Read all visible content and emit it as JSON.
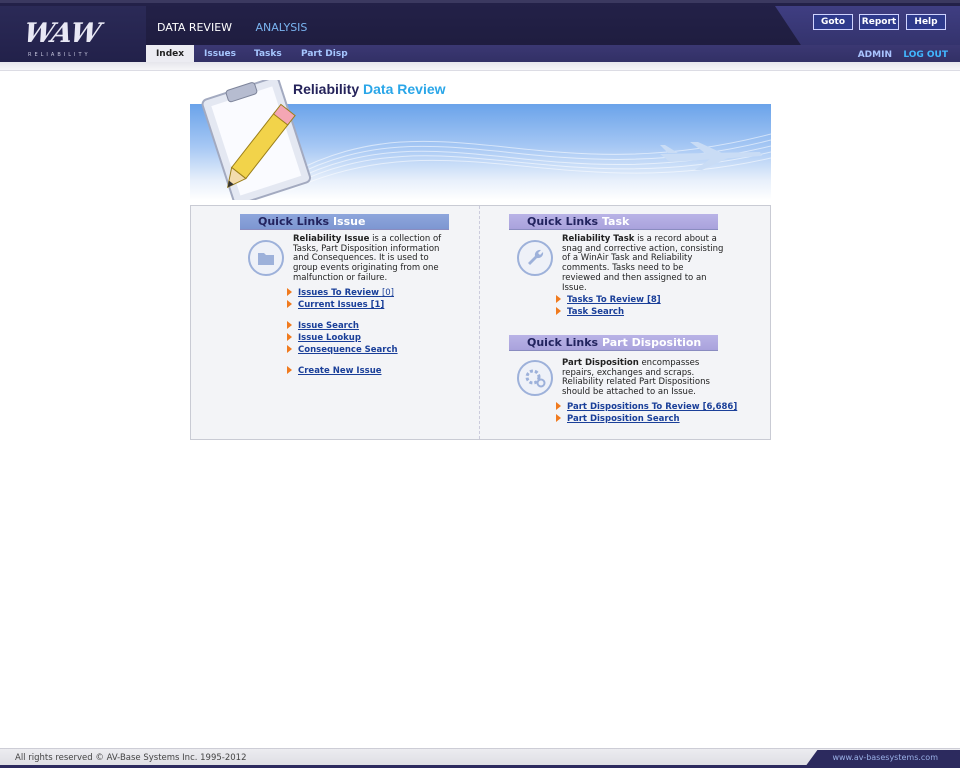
{
  "header": {
    "logo_text": "WAW",
    "logo_sub": "RELIABILITY",
    "top_nav": [
      "DATA REVIEW",
      "ANALYSIS"
    ],
    "tabs": [
      "Index",
      "Issues",
      "Tasks",
      "Part Disp"
    ],
    "buttons": {
      "goto": "Goto",
      "report": "Report",
      "help": "Help"
    },
    "user": "ADMIN",
    "logout": "LOG OUT"
  },
  "banner": {
    "title_part1": "Reliability",
    "title_part2": "Data Review"
  },
  "issue": {
    "heading_prefix": "Quick Links",
    "heading": "Issue",
    "desc_bold": "Reliability Issue",
    "desc_rest": "is a collection of Tasks, Part Disposition information and Consequences. It is used to group events originating from one malfunction or failure.",
    "links": [
      {
        "label": "Issues To Review",
        "count": "[0]"
      },
      {
        "label": "Current Issues [1]",
        "count": ""
      },
      {
        "label": "Issue Search",
        "count": ""
      },
      {
        "label": "Issue Lookup",
        "count": ""
      },
      {
        "label": "Consequence Search",
        "count": ""
      },
      {
        "label": "Create New Issue",
        "count": ""
      }
    ]
  },
  "task": {
    "heading_prefix": "Quick Links",
    "heading": "Task",
    "desc_bold": "Reliability Task",
    "desc_rest": "is a record about a snag and corrective action, consisting of a WinAir Task and Reliability comments. Tasks need to be reviewed and then assigned to an Issue.",
    "links": [
      {
        "label": "Tasks To Review [8]"
      },
      {
        "label": "Task Search"
      }
    ]
  },
  "partdisp": {
    "heading_prefix": "Quick Links",
    "heading": "Part Disposition",
    "desc_bold": "Part Disposition",
    "desc_rest": "encompasses repairs, exchanges and scraps. Reliability related Part Dispositions should be attached to an Issue.",
    "links": [
      {
        "label": "Part Dispositions To Review [6,686]"
      },
      {
        "label": "Part Disposition Search"
      }
    ]
  },
  "footer": {
    "copyright": "All rights reserved © AV-Base Systems Inc. 1995-2012",
    "url": "www.av-basesystems.com"
  },
  "colors": {
    "nav_bg": "#232148",
    "link": "#1a3f99",
    "arrow": "#f07a1e",
    "accent": "#2aa6e8"
  }
}
